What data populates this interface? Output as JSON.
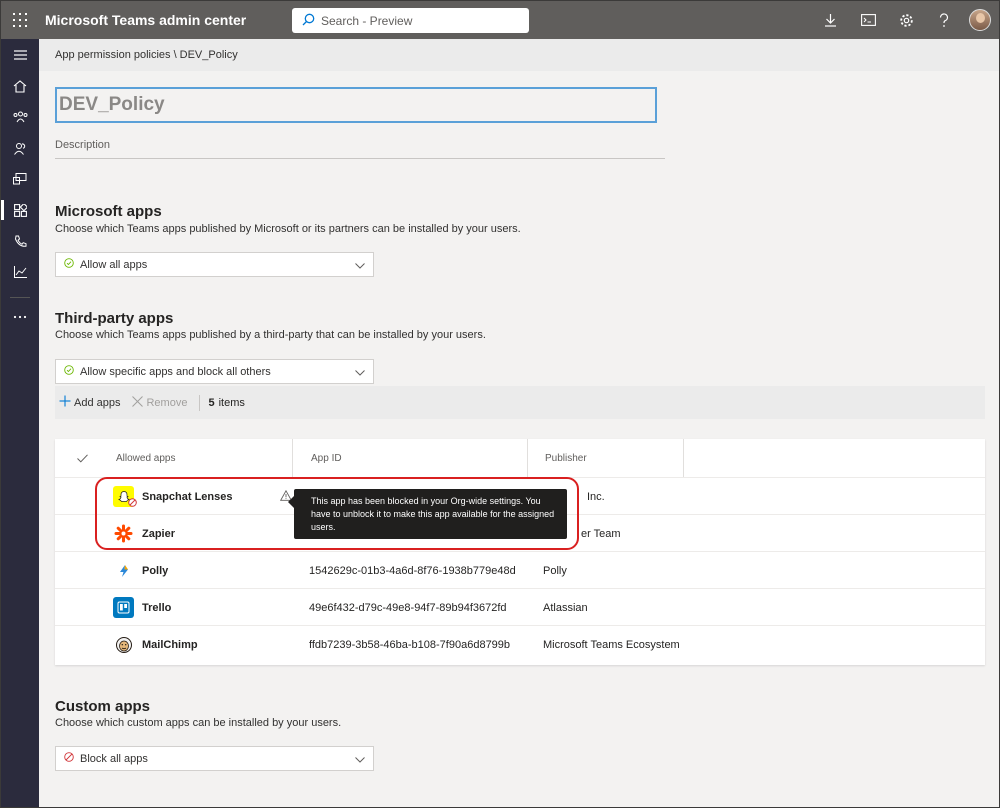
{
  "header": {
    "app_title": "Microsoft Teams admin center",
    "search_placeholder": "Search - Preview"
  },
  "breadcrumb": {
    "parent": "App permission policies",
    "separator": "\\",
    "current": "DEV_Policy"
  },
  "policy": {
    "name_value": "DEV_Policy",
    "description_placeholder": "Description"
  },
  "microsoft_apps": {
    "title": "Microsoft apps",
    "subtitle": "Choose which Teams apps published by Microsoft or its partners can be installed by your users.",
    "selected": "Allow all apps"
  },
  "third_party_apps": {
    "title": "Third-party apps",
    "subtitle": "Choose which Teams apps published by a third-party that can be installed by your users.",
    "selected": "Allow specific apps and block all others",
    "toolbar": {
      "add_label": "Add apps",
      "remove_label": "Remove",
      "count": "5",
      "count_suffix": "items"
    },
    "columns": [
      "Allowed apps",
      "App ID",
      "Publisher"
    ],
    "rows": [
      {
        "name": "Snapchat Lenses",
        "app_id": "",
        "publisher": "Inc.",
        "icon": "snapchat-icon"
      },
      {
        "name": "Zapier",
        "app_id": "",
        "publisher": "er Team",
        "icon": "zapier-icon"
      },
      {
        "name": "Polly",
        "app_id": "1542629c-01b3-4a6d-8f76-1938b779e48d",
        "publisher": "Polly",
        "icon": "polly-icon"
      },
      {
        "name": "Trello",
        "app_id": "49e6f432-d79c-49e8-94f7-89b94f3672fd",
        "publisher": "Atlassian",
        "icon": "trello-icon"
      },
      {
        "name": "MailChimp",
        "app_id": "ffdb7239-3b58-46ba-b108-7f90a6d8799b",
        "publisher": "Microsoft Teams Ecosystem",
        "icon": "mailchimp-icon"
      }
    ],
    "tooltip": "This app has been blocked in your Org-wide settings. You have to unblock it to make this app available for the assigned users."
  },
  "custom_apps": {
    "title": "Custom apps",
    "subtitle": "Choose which custom apps can be installed by your users.",
    "selected": "Block all apps"
  },
  "colors": {
    "topbar": "#605e5c",
    "rail": "#2b2b3d",
    "highlight": "#d92020",
    "allow_icon": "#6bb700",
    "block_icon": "#d13438"
  }
}
